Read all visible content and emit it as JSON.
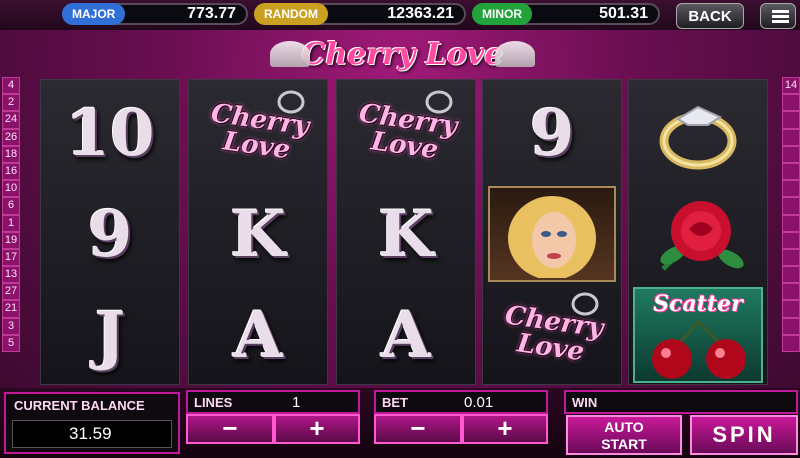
{
  "jackpots": [
    {
      "label": "MAJOR",
      "value": "773.77",
      "color": "#2f6fd6"
    },
    {
      "label": "RANDOM",
      "value": "12363.21",
      "color": "#c9a020"
    },
    {
      "label": "MINOR",
      "value": "501.31",
      "color": "#22a23a"
    }
  ],
  "header": {
    "back_label": "BACK",
    "menu_icon": "hamburger-menu-icon"
  },
  "game_title": "Cherry Love",
  "paylines_left": [
    "4",
    "2",
    "24",
    "26",
    "18",
    "16",
    "10",
    "6",
    "1",
    "19",
    "17",
    "13",
    "27",
    "21",
    "3",
    "5"
  ],
  "paylines_right": [
    "14",
    "",
    "",
    "",
    "",
    "",
    "",
    "",
    "",
    "",
    "",
    "",
    "",
    "",
    "",
    ""
  ],
  "reels": [
    [
      {
        "type": "card",
        "text": "10"
      },
      {
        "type": "card",
        "text": "9"
      },
      {
        "type": "card",
        "text": "J"
      }
    ],
    [
      {
        "type": "logo",
        "text": "Cherry Love"
      },
      {
        "type": "card",
        "text": "K"
      },
      {
        "type": "card",
        "text": "A"
      }
    ],
    [
      {
        "type": "logo",
        "text": "Cherry Love"
      },
      {
        "type": "card",
        "text": "K"
      },
      {
        "type": "card",
        "text": "A"
      }
    ],
    [
      {
        "type": "card",
        "text": "9"
      },
      {
        "type": "portrait",
        "text": ""
      },
      {
        "type": "logo",
        "text": "Cherry Love"
      }
    ],
    [
      {
        "type": "ring",
        "text": ""
      },
      {
        "type": "rose",
        "text": ""
      },
      {
        "type": "scatter",
        "text": "Scatter"
      }
    ]
  ],
  "balance": {
    "label": "CURRENT BALANCE",
    "value": "31.59"
  },
  "lines": {
    "label": "LINES",
    "value": "1",
    "minus": "−",
    "plus": "+"
  },
  "bet": {
    "label": "BET",
    "value": "0.01",
    "minus": "−",
    "plus": "+"
  },
  "win": {
    "label": "WIN",
    "value": ""
  },
  "buttons": {
    "auto_start_line1": "AUTO",
    "auto_start_line2": "START",
    "spin": "SPIN"
  }
}
